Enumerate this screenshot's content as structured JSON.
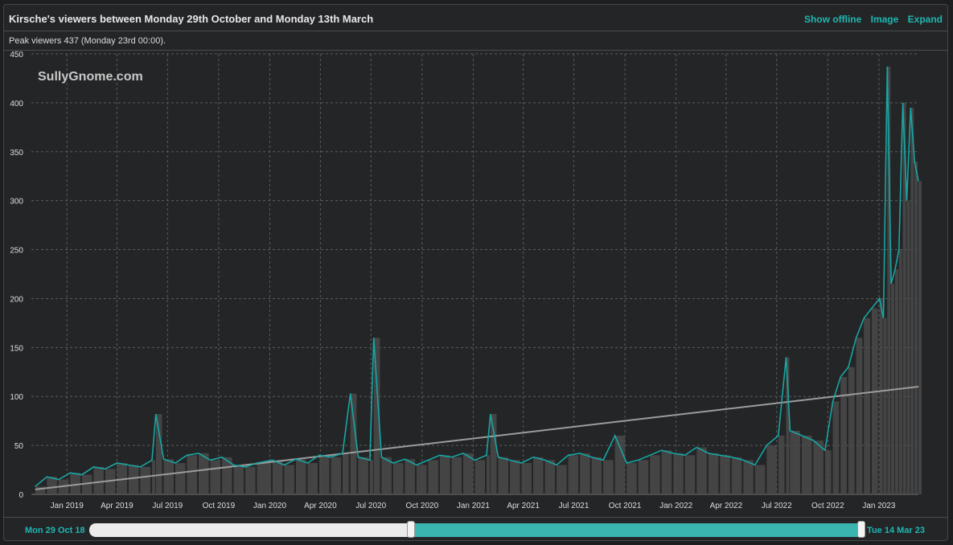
{
  "header": {
    "title": "Kirsche's viewers between Monday 29th October and Monday 13th March",
    "actions": [
      "Show offline",
      "Image",
      "Expand"
    ]
  },
  "subheader": {
    "peak_text": "Peak viewers 437 (Monday 23rd 00:00)."
  },
  "watermark": "SullyGnome.com",
  "footer": {
    "range_start": "Mon 29 Oct 18",
    "range_end": "Tue 14 Mar 23",
    "selection_fraction": [
      0.415,
      1.0
    ]
  },
  "colors": {
    "line": "#17a6a3",
    "bars": "#4a4a4a",
    "trend": "#9c9c9c",
    "grid": "#5a5c5e",
    "axis_text": "#dcdcdc",
    "accent": "#1fb7b2"
  },
  "chart_data": {
    "type": "line",
    "title": "Kirsche's viewers between Monday 29th October and Monday 13th March",
    "ylim": [
      0,
      450
    ],
    "yticks": [
      0,
      50,
      100,
      150,
      200,
      250,
      300,
      350,
      400,
      450
    ],
    "xlim": [
      "2018-10-29",
      "2023-03-13"
    ],
    "xticks": [
      {
        "date": "2019-01-01",
        "label": "Jan 2019"
      },
      {
        "date": "2019-04-01",
        "label": "Apr 2019"
      },
      {
        "date": "2019-07-01",
        "label": "Jul 2019"
      },
      {
        "date": "2019-10-01",
        "label": "Oct 2019"
      },
      {
        "date": "2020-01-01",
        "label": "Jan 2020"
      },
      {
        "date": "2020-04-01",
        "label": "Apr 2020"
      },
      {
        "date": "2020-07-01",
        "label": "Jul 2020"
      },
      {
        "date": "2020-10-01",
        "label": "Oct 2020"
      },
      {
        "date": "2021-01-01",
        "label": "Jan 2021"
      },
      {
        "date": "2021-04-01",
        "label": "Apr 2021"
      },
      {
        "date": "2021-07-01",
        "label": "Jul 2021"
      },
      {
        "date": "2021-10-01",
        "label": "Oct 2021"
      },
      {
        "date": "2022-01-01",
        "label": "Jan 2022"
      },
      {
        "date": "2022-04-01",
        "label": "Apr 2022"
      },
      {
        "date": "2022-07-01",
        "label": "Jul 2022"
      },
      {
        "date": "2022-10-01",
        "label": "Oct 2022"
      },
      {
        "date": "2023-01-01",
        "label": "Jan 2023"
      }
    ],
    "trend": {
      "start": [
        "2018-11-05",
        5
      ],
      "end": [
        "2023-03-13",
        110
      ]
    },
    "series": [
      {
        "points": [
          [
            "2018-11-05",
            8
          ],
          [
            "2018-11-26",
            18
          ],
          [
            "2018-12-17",
            15
          ],
          [
            "2019-01-07",
            22
          ],
          [
            "2019-01-28",
            20
          ],
          [
            "2019-02-18",
            28
          ],
          [
            "2019-03-11",
            26
          ],
          [
            "2019-04-01",
            32
          ],
          [
            "2019-04-22",
            30
          ],
          [
            "2019-05-13",
            28
          ],
          [
            "2019-06-03",
            35
          ],
          [
            "2019-06-10",
            82
          ],
          [
            "2019-06-24",
            36
          ],
          [
            "2019-07-15",
            32
          ],
          [
            "2019-08-05",
            40
          ],
          [
            "2019-08-26",
            42
          ],
          [
            "2019-09-16",
            35
          ],
          [
            "2019-10-07",
            38
          ],
          [
            "2019-10-28",
            30
          ],
          [
            "2019-11-18",
            28
          ],
          [
            "2019-12-09",
            32
          ],
          [
            "2020-01-06",
            35
          ],
          [
            "2020-01-27",
            30
          ],
          [
            "2020-02-17",
            36
          ],
          [
            "2020-03-09",
            32
          ],
          [
            "2020-03-30",
            40
          ],
          [
            "2020-04-20",
            38
          ],
          [
            "2020-05-11",
            42
          ],
          [
            "2020-05-25",
            103
          ],
          [
            "2020-06-08",
            38
          ],
          [
            "2020-06-29",
            35
          ],
          [
            "2020-07-06",
            160
          ],
          [
            "2020-07-20",
            38
          ],
          [
            "2020-08-10",
            32
          ],
          [
            "2020-08-31",
            36
          ],
          [
            "2020-09-21",
            30
          ],
          [
            "2020-10-12",
            35
          ],
          [
            "2020-11-02",
            40
          ],
          [
            "2020-11-23",
            38
          ],
          [
            "2020-12-14",
            42
          ],
          [
            "2021-01-04",
            35
          ],
          [
            "2021-01-25",
            40
          ],
          [
            "2021-02-01",
            82
          ],
          [
            "2021-02-15",
            38
          ],
          [
            "2021-03-08",
            35
          ],
          [
            "2021-03-29",
            32
          ],
          [
            "2021-04-19",
            38
          ],
          [
            "2021-05-10",
            35
          ],
          [
            "2021-05-31",
            30
          ],
          [
            "2021-06-21",
            40
          ],
          [
            "2021-07-12",
            42
          ],
          [
            "2021-08-02",
            38
          ],
          [
            "2021-08-23",
            35
          ],
          [
            "2021-09-13",
            60
          ],
          [
            "2021-10-04",
            32
          ],
          [
            "2021-10-25",
            35
          ],
          [
            "2021-11-15",
            40
          ],
          [
            "2021-12-06",
            45
          ],
          [
            "2021-12-27",
            42
          ],
          [
            "2022-01-17",
            40
          ],
          [
            "2022-02-07",
            48
          ],
          [
            "2022-02-28",
            42
          ],
          [
            "2022-03-21",
            40
          ],
          [
            "2022-04-11",
            38
          ],
          [
            "2022-05-02",
            35
          ],
          [
            "2022-05-23",
            30
          ],
          [
            "2022-06-13",
            50
          ],
          [
            "2022-07-04",
            60
          ],
          [
            "2022-07-18",
            140
          ],
          [
            "2022-07-25",
            65
          ],
          [
            "2022-08-15",
            60
          ],
          [
            "2022-09-05",
            55
          ],
          [
            "2022-09-26",
            45
          ],
          [
            "2022-10-10",
            95
          ],
          [
            "2022-10-24",
            120
          ],
          [
            "2022-11-07",
            130
          ],
          [
            "2022-11-21",
            160
          ],
          [
            "2022-12-05",
            180
          ],
          [
            "2022-12-19",
            190
          ],
          [
            "2023-01-02",
            200
          ],
          [
            "2023-01-09",
            180
          ],
          [
            "2023-01-16",
            437
          ],
          [
            "2023-01-23",
            215
          ],
          [
            "2023-01-30",
            230
          ],
          [
            "2023-02-06",
            250
          ],
          [
            "2023-02-13",
            400
          ],
          [
            "2023-02-20",
            300
          ],
          [
            "2023-02-27",
            395
          ],
          [
            "2023-03-06",
            340
          ],
          [
            "2023-03-13",
            320
          ]
        ]
      }
    ]
  }
}
